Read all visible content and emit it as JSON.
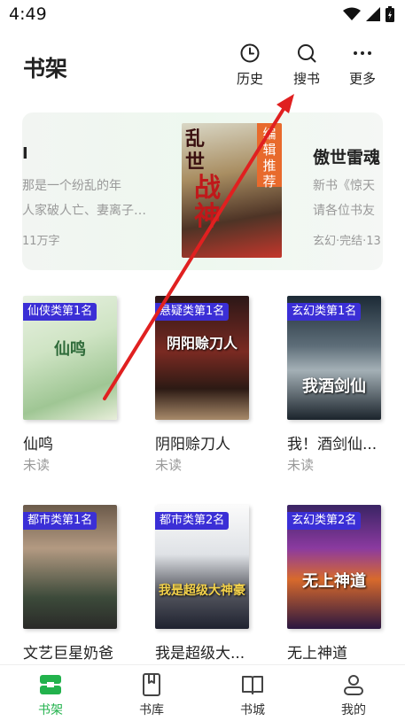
{
  "status_bar": {
    "time": "4:49"
  },
  "header": {
    "title": "书架",
    "buttons": [
      {
        "icon": "clock-icon",
        "label": "历史"
      },
      {
        "icon": "search-icon",
        "label": "搜书"
      },
      {
        "icon": "more-icon",
        "label": "更多"
      }
    ]
  },
  "banner": {
    "left": {
      "title": "I",
      "line1": "那是一个纷乱的年",
      "line2": "人家破人亡、妻离子…",
      "line3": "11万字"
    },
    "center": {
      "cover_title": "乱世战神",
      "cover_top": "乱世",
      "cover_bottom": "战神",
      "badge": "编辑推荐"
    },
    "right": {
      "title": "傲世雷魂",
      "line1": "新书《惊天",
      "line2": "请各位书友",
      "line3": "玄幻·完结·13"
    }
  },
  "books": [
    {
      "rank": "仙侠类第1名",
      "name": "仙鸣",
      "status": "未读",
      "cover_text": "仙鸣"
    },
    {
      "rank": "悬疑类第1名",
      "name": "阴阳赊刀人",
      "status": "未读",
      "cover_text": "阴阳赊刀人"
    },
    {
      "rank": "玄幻类第1名",
      "name": "我！酒剑仙...",
      "status": "未读",
      "cover_text": "我酒剑仙"
    },
    {
      "rank": "都市类第1名",
      "name": "文艺巨星奶爸",
      "status": "",
      "cover_text": ""
    },
    {
      "rank": "都市类第2名",
      "name": "我是超级大...",
      "status": "",
      "cover_text": "我是超级大神豪"
    },
    {
      "rank": "玄幻类第2名",
      "name": "无上神道",
      "status": "",
      "cover_text": "无上神道"
    }
  ],
  "bottom_nav": [
    {
      "icon": "bookshelf-icon",
      "label": "书架",
      "active": true
    },
    {
      "icon": "library-icon",
      "label": "书库",
      "active": false
    },
    {
      "icon": "bookcity-icon",
      "label": "书城",
      "active": false
    },
    {
      "icon": "profile-icon",
      "label": "我的",
      "active": false
    }
  ],
  "colors": {
    "accent": "#22b24c",
    "rank_badge": "#3b2fd6",
    "annotation_arrow": "#e02020"
  }
}
